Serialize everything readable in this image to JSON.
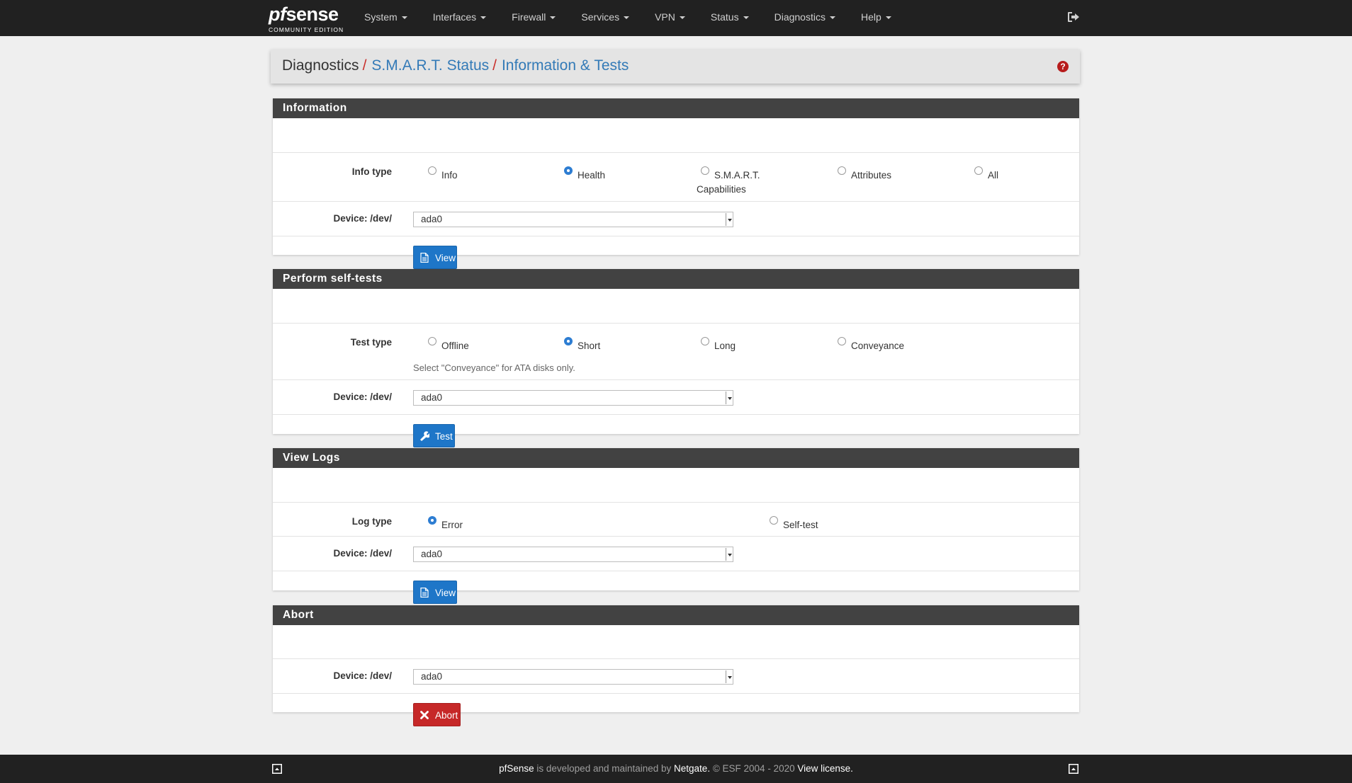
{
  "brand": {
    "logo_pf": "pf",
    "logo_sense": "sense",
    "subtitle": "COMMUNITY EDITION"
  },
  "nav": {
    "items": [
      {
        "label": "System"
      },
      {
        "label": "Interfaces"
      },
      {
        "label": "Firewall"
      },
      {
        "label": "Services"
      },
      {
        "label": "VPN"
      },
      {
        "label": "Status"
      },
      {
        "label": "Diagnostics"
      },
      {
        "label": "Help"
      }
    ],
    "logout_icon": "sign-out-icon"
  },
  "breadcrumb": {
    "root": "Diagnostics",
    "separator": "/",
    "items": [
      "S.M.A.R.T. Status",
      "Information & Tests"
    ],
    "help_icon": "question-circle-icon",
    "help_glyph": "?"
  },
  "panels": {
    "information": {
      "title": "Information",
      "info_type_label": "Info type",
      "options": [
        {
          "label": "Info",
          "checked": false
        },
        {
          "label": "Health",
          "checked": true
        },
        {
          "label": "S.M.A.R.T.",
          "label2": "Capabilities",
          "checked": false
        },
        {
          "label": "Attributes",
          "checked": false
        },
        {
          "label": "All",
          "checked": false
        }
      ],
      "device_label": "Device: /dev/",
      "device_value": "ada0",
      "button_label": "View",
      "button_icon": "file-text-icon"
    },
    "selftests": {
      "title": "Perform self-tests",
      "test_type_label": "Test type",
      "options": [
        {
          "label": "Offline",
          "checked": false
        },
        {
          "label": "Short",
          "checked": true
        },
        {
          "label": "Long",
          "checked": false
        },
        {
          "label": "Conveyance",
          "checked": false
        }
      ],
      "help_text": "Select \"Conveyance\" for ATA disks only.",
      "device_label": "Device: /dev/",
      "device_value": "ada0",
      "button_label": "Test",
      "button_icon": "wrench-icon"
    },
    "logs": {
      "title": "View Logs",
      "log_type_label": "Log type",
      "options": [
        {
          "label": "Error",
          "checked": true
        },
        {
          "label": "Self-test",
          "checked": false
        }
      ],
      "device_label": "Device: /dev/",
      "device_value": "ada0",
      "button_label": "View",
      "button_icon": "file-text-icon"
    },
    "abort": {
      "title": "Abort",
      "device_label": "Device: /dev/",
      "device_value": "ada0",
      "button_label": "Abort",
      "button_icon": "times-icon"
    }
  },
  "footer": {
    "product": "pfSense",
    "text1": " is developed and maintained by ",
    "company": "Netgate.",
    "text2": " © ESF 2004 - 2020 ",
    "license_link": "View license.",
    "left_icon": "collapse-icon",
    "right_icon": "collapse-icon"
  },
  "colors": {
    "navbar": "#212121",
    "panel_heading": "#424242",
    "primary": "#1e76c8",
    "danger": "#c62828",
    "link": "#337ab7"
  }
}
